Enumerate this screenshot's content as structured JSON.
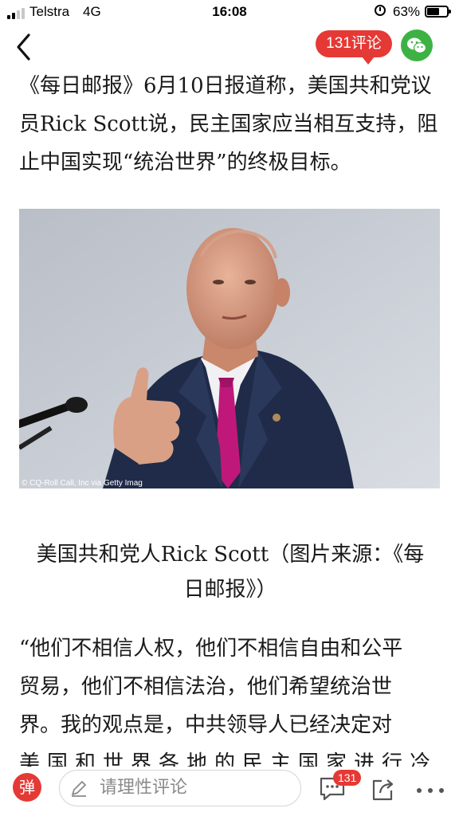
{
  "status_bar": {
    "carrier": "Telstra",
    "network": "4G",
    "time": "16:08",
    "battery_percent_label": "63%",
    "battery_level": 0.63
  },
  "nav": {
    "comment_button_label": "131评论",
    "icons": [
      "back-arrow-icon",
      "wechat-icon"
    ],
    "accent_color": "#e53935",
    "wechat_color": "#3db244"
  },
  "article": {
    "paragraph_1": "《每日邮报》6月10日报道称，美国共和党议员Rick Scott说，民主国家应当相互支持，阻止中国实现“统治世界”的终极目标。",
    "image_credit": "© CQ-Roll Call, Inc via Getty Imag",
    "caption_line_1": "美国共和党人Rick Scott（图片来源：《每",
    "caption_line_2": "日邮报》）",
    "paragraph_2_lines": [
      "“他们不相信人权，他们不相信自由和公平",
      "贸易，他们不相信法治，他们希望统治世",
      "界。我的观点是，中共领导人已经决定对",
      "美国和世界各地的民主国家进行冷"
    ]
  },
  "bottom_bar": {
    "danmu_label": "弹",
    "comment_placeholder": "请理性评论",
    "comment_count_badge": "131",
    "icons": [
      "pencil-icon",
      "comment-icon",
      "share-icon",
      "more-icon"
    ]
  }
}
